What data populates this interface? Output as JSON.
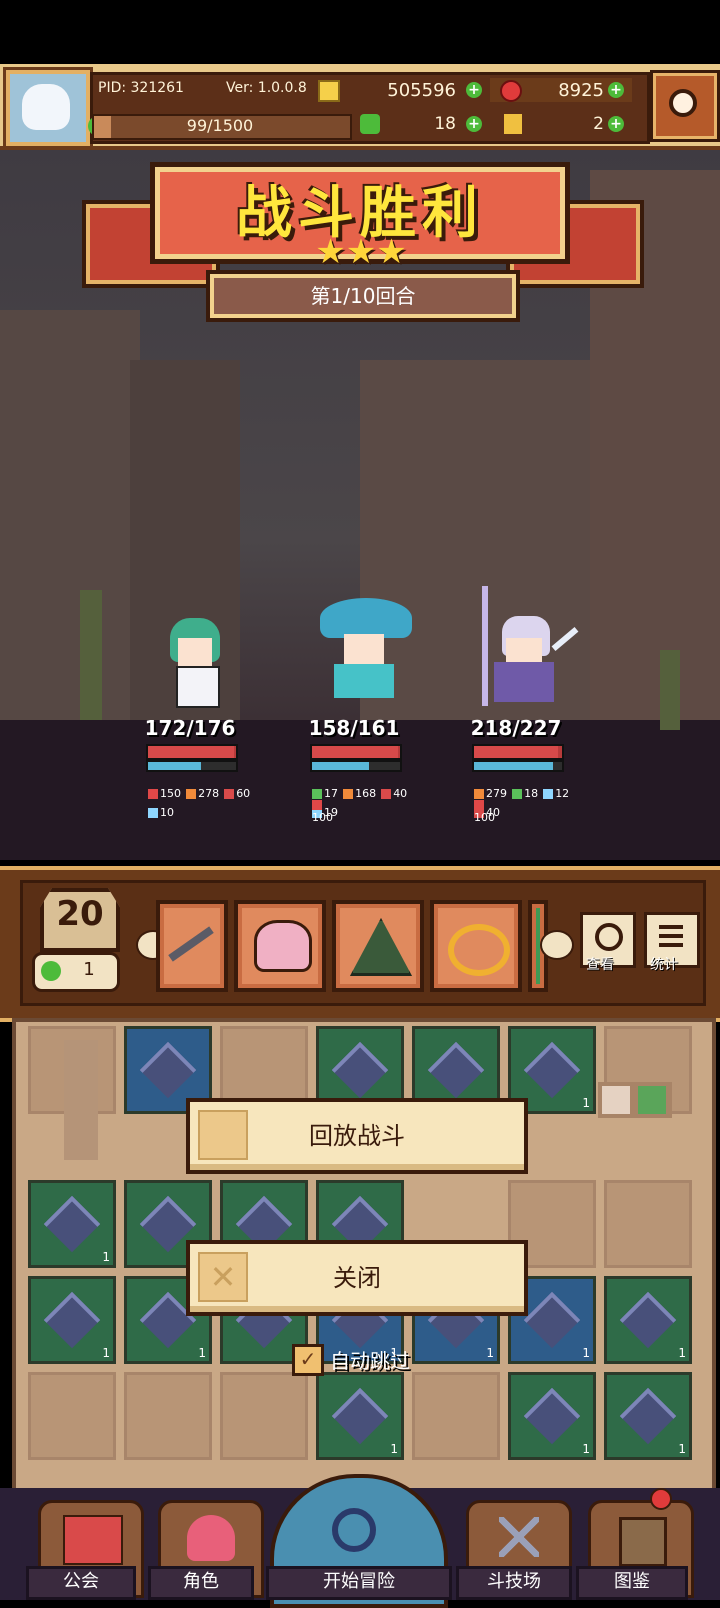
{
  "header": {
    "pid_label": "PID: 321261",
    "version_label": "Ver: 1.0.0.8",
    "gold": "505596",
    "ruby": "8925",
    "energy": "99/1500",
    "energy_fraction": 0.066,
    "clover": "18",
    "key": "2"
  },
  "result": {
    "title": "战斗胜利",
    "stars": 3,
    "round_text": "第1/10回合"
  },
  "heroes": [
    {
      "hp": "172/176",
      "hp_frac": 0.977,
      "mp_frac": 0.6,
      "stats": [
        "150",
        "278",
        "60",
        "10"
      ],
      "extra": ""
    },
    {
      "hp": "158/161",
      "hp_frac": 0.98,
      "mp_frac": 0.65,
      "stats": [
        "17",
        "168",
        "40",
        "19"
      ],
      "extra": "100"
    },
    {
      "hp": "218/227",
      "hp_frac": 0.96,
      "mp_frac": 0.9,
      "stats": [
        "279",
        "18",
        "12",
        "40"
      ],
      "extra": "100"
    }
  ],
  "itembar": {
    "level": "20",
    "clover_count": "1",
    "view_label": "查看",
    "stats_label": "统计"
  },
  "dialog": {
    "replay_label": "回放战斗",
    "close_label": "关闭",
    "autoskip_label": "自动跳过",
    "autoskip_checked": true
  },
  "nav": {
    "guild": "公会",
    "character": "角色",
    "adventure": "开始冒险",
    "arena": "斗技场",
    "codex": "图鉴"
  },
  "tile_num": "1",
  "colors": {
    "accent_gold": "#ffe63d",
    "banner_red": "#e6634a",
    "hp_red": "#b83b3b",
    "mp_blue": "#5ab8d8"
  }
}
